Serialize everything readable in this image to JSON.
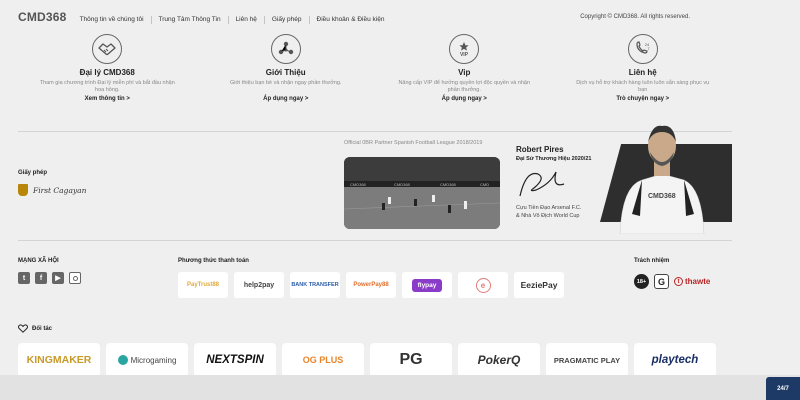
{
  "brand": {
    "logo": "CMD368"
  },
  "nav": {
    "items": [
      {
        "label": "Thông tin về chúng tôi"
      },
      {
        "label": "Trung Tâm Thông Tin"
      },
      {
        "label": "Liên hệ"
      },
      {
        "label": "Giấy phép"
      },
      {
        "label": "Điều khoản & Điều kiện"
      }
    ],
    "copyright": "Copyright © CMD368. All rights reserved."
  },
  "features": [
    {
      "icon": "handshake-icon",
      "title": "Đại lý CMD368",
      "desc": "Tham gia chương trình Đại lý miễn phí và bắt đầu nhận hoa hồng.",
      "link": "Xem thông tin >"
    },
    {
      "icon": "network-icon",
      "title": "Giới Thiệu",
      "desc": "Giới thiệu bạn bè và nhận ngay phần thưởng.",
      "link": "Áp dụng ngay >"
    },
    {
      "icon": "vip-badge-icon",
      "title": "Vip",
      "desc": "Nâng cấp VIP để hưởng quyền lợi độc quyền và nhận phần thưởng.",
      "link": "Áp dụng ngay >"
    },
    {
      "icon": "phone-24-7-icon",
      "title": "Liên hệ",
      "desc": "Dịch vụ hỗ trợ khách hàng luôn luôn sẵn sàng phục vụ bạn",
      "link": "Trò chuyện ngay >"
    }
  ],
  "license": {
    "label": "Giấy phép",
    "name": "First Cagayan"
  },
  "partner_caption": "Official 0BR Partner Spanish Football League 2018/2019",
  "ambassador": {
    "name": "Robert Pires",
    "role": "Đại Sứ Thương Hiệu 2020/21",
    "line1": "Cựu Tiền Đạo Arsenal F.C.",
    "line2": "& Nhà Vô Địch World Cup",
    "shirt": "CMD368"
  },
  "social": {
    "label": "MẠNG XÃ HỘI",
    "icons": [
      "twitter-icon",
      "facebook-icon",
      "youtube-icon",
      "instagram-icon"
    ]
  },
  "payment": {
    "label": "Phương thức thanh toán",
    "methods": [
      {
        "name": "PayTrust88"
      },
      {
        "name": "help2pay"
      },
      {
        "name": "BANK TRANSFER"
      },
      {
        "name": "PowerPay88"
      },
      {
        "name": "flypay"
      },
      {
        "name": "e"
      },
      {
        "name": "EeziePay"
      }
    ]
  },
  "responsibility": {
    "label": "Trách nhiệm",
    "age": "18+",
    "gamcare": "G",
    "thawte": "thawte"
  },
  "partners": {
    "label": "Đối tác",
    "items": [
      {
        "name": "KINGMAKER"
      },
      {
        "name": "Microgaming"
      },
      {
        "name": "NEXTSPIN"
      },
      {
        "name": "OG PLUS"
      },
      {
        "name": "PG"
      },
      {
        "name": "PokerQ"
      },
      {
        "name": "PRAGMATIC PLAY"
      },
      {
        "name": "playtech"
      }
    ]
  },
  "live_chat": "24/7"
}
